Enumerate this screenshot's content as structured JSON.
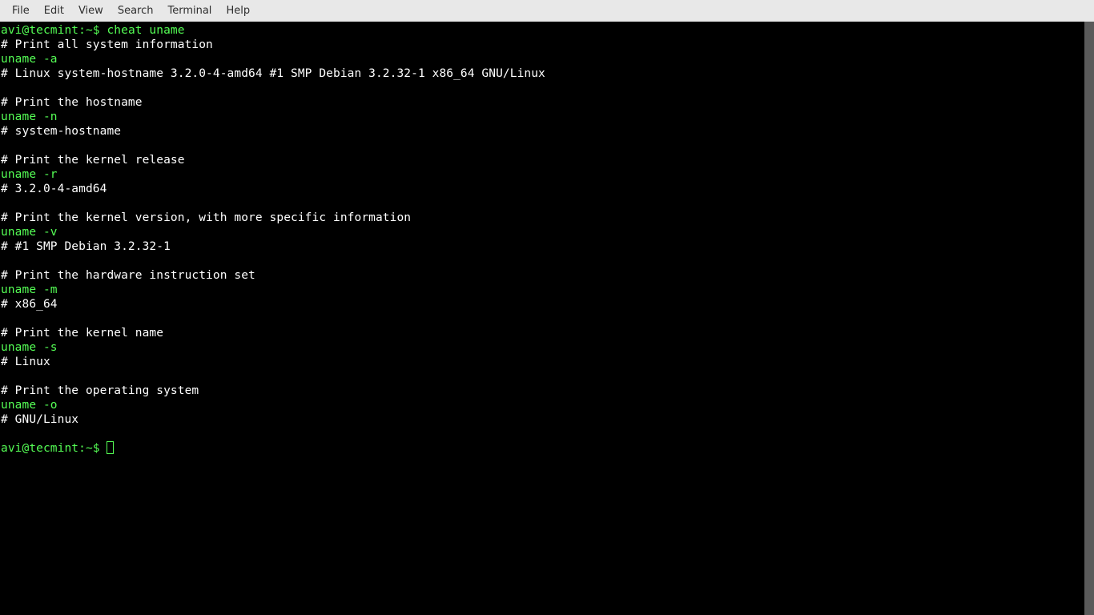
{
  "menubar": {
    "file": "File",
    "edit": "Edit",
    "view": "View",
    "search": "Search",
    "terminal": "Terminal",
    "help": "Help"
  },
  "terminal": {
    "prompt1": "avi@tecmint:~$ ",
    "command1": "cheat uname",
    "lines": [
      "# Print all system information",
      "uname -a",
      "# Linux system-hostname 3.2.0-4-amd64 #1 SMP Debian 3.2.32-1 x86_64 GNU/Linux",
      "",
      "# Print the hostname",
      "uname -n",
      "# system-hostname",
      "",
      "# Print the kernel release",
      "uname -r",
      "# 3.2.0-4-amd64",
      "",
      "# Print the kernel version, with more specific information",
      "uname -v",
      "# #1 SMP Debian 3.2.32-1",
      "",
      "# Print the hardware instruction set",
      "uname -m",
      "# x86_64",
      "",
      "# Print the kernel name",
      "uname -s",
      "# Linux",
      "",
      "# Print the operating system",
      "uname -o",
      "# GNU/Linux",
      ""
    ],
    "line_colors": [
      "white",
      "green",
      "white",
      "white",
      "white",
      "green",
      "white",
      "white",
      "white",
      "green",
      "white",
      "white",
      "white",
      "green",
      "white",
      "white",
      "white",
      "green",
      "white",
      "white",
      "white",
      "green",
      "white",
      "white",
      "white",
      "green",
      "white",
      "white"
    ],
    "prompt2": "avi@tecmint:~$ "
  }
}
